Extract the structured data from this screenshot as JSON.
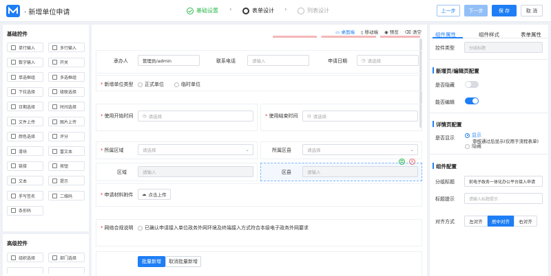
{
  "header": {
    "title": "新增单位申请",
    "steps": [
      {
        "label": "基础设置",
        "state": "done"
      },
      {
        "label": "表单设计",
        "state": "active"
      },
      {
        "label": "列表设计",
        "state": "pending"
      }
    ],
    "buttons": {
      "prev": "上一步",
      "next": "下一步",
      "save": "保 存",
      "cancel": "取 消"
    }
  },
  "left": {
    "basic_title": "基础控件",
    "basic": [
      "单行输入",
      "多行输入",
      "数字输入",
      "开关",
      "单选框组",
      "多选框组",
      "下拉选择",
      "级联选择",
      "日期选择",
      "时间选择",
      "文件上传",
      "图片上传",
      "颜色选择",
      "评分",
      "滑块",
      "富文本",
      "链接",
      "按钮",
      "文本",
      "提示",
      "手写签名",
      "二维码",
      "条形码"
    ],
    "advanced_title": "高级控件",
    "advanced": [
      "组织选择",
      "部门选择"
    ]
  },
  "center": {
    "toolbar": {
      "desktop": "桌面端",
      "mobile": "移动端",
      "preview": "预览",
      "clear": "清空"
    },
    "applicant": {
      "label": "承办人",
      "value": "管理员/admin"
    },
    "phone": {
      "label": "联系电话",
      "placeholder": "请输入"
    },
    "apply_date": {
      "label": "申请日期",
      "placeholder": "请选择"
    },
    "unit_type": {
      "label": "新增单位类型",
      "options": [
        "正式单位",
        "临时单位"
      ]
    },
    "start_time": {
      "label": "使用开始时间",
      "placeholder": "请选择"
    },
    "end_time": {
      "label": "使用结束时间",
      "placeholder": "请选择"
    },
    "area": {
      "label": "所属区域",
      "placeholder": "请选择"
    },
    "county": {
      "label": "所属区县",
      "placeholder": "请选择"
    },
    "region": {
      "label": "区域",
      "placeholder": "请输入"
    },
    "district": {
      "label": "区县",
      "placeholder": "请输入"
    },
    "attachment": {
      "label": "申请材料附件",
      "button": "点击上传"
    },
    "compliance": {
      "label": "网络合规说明",
      "text": "已确认申请接入单位政务外网环境及终端接入方式符合本级电子政务外网要求"
    },
    "batch": {
      "add": "批量新增",
      "cancel": "取消批量新增"
    }
  },
  "right": {
    "tabs": [
      "组件属性",
      "组件样式",
      "表单属性"
    ],
    "control_type": {
      "label": "控件类型",
      "value": "分组标题"
    },
    "section1": "新增页/编辑页配置",
    "hide": {
      "label": "是否隐藏",
      "on": false
    },
    "edit": {
      "label": "能否编辑",
      "on": true
    },
    "section2": "详情页配置",
    "show": {
      "label": "是否显示",
      "opt1": "显示",
      "opt1_sub": "审核通过后显示(仅用于流程表单)",
      "opt2": "隐藏"
    },
    "section3": "组件配置",
    "group_title": {
      "label": "分组标题",
      "value": "前电子政务一体化办公平台接入申请"
    },
    "title_hint": {
      "label": "标题提示",
      "placeholder": "请输入标题提示"
    },
    "align": {
      "label": "对齐方式",
      "options": [
        "左对齐",
        "居中对齐",
        "右对齐"
      ],
      "selected": 1
    }
  },
  "colors": {
    "accent": "#1e7ef5",
    "done": "#2db84d"
  }
}
